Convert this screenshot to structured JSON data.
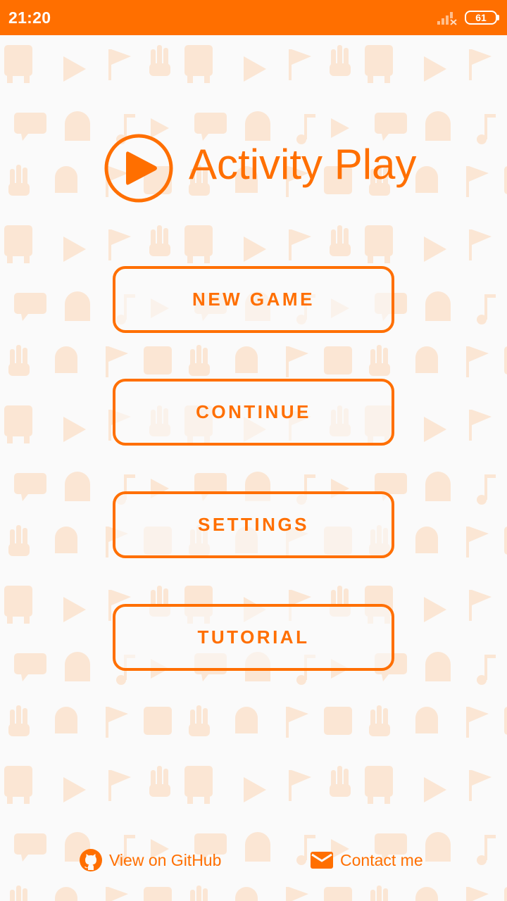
{
  "status_bar": {
    "time": "21:20",
    "battery_level": "61",
    "signal_icon": "signal-no-service-icon",
    "battery_icon": "battery-icon"
  },
  "app": {
    "title": "Activity Play",
    "logo_icon": "play-circle-icon"
  },
  "menu": {
    "new_game": "NEW GAME",
    "continue": "CONTINUE",
    "settings": "SETTINGS",
    "tutorial": "TUTORIAL"
  },
  "footer": {
    "github_label": "View on GitHub",
    "github_icon": "github-icon",
    "contact_label": "Contact me",
    "contact_icon": "mail-icon"
  },
  "colors": {
    "accent": "#ff6f00",
    "background": "#fafafa",
    "pattern": "#fbe6d4"
  }
}
